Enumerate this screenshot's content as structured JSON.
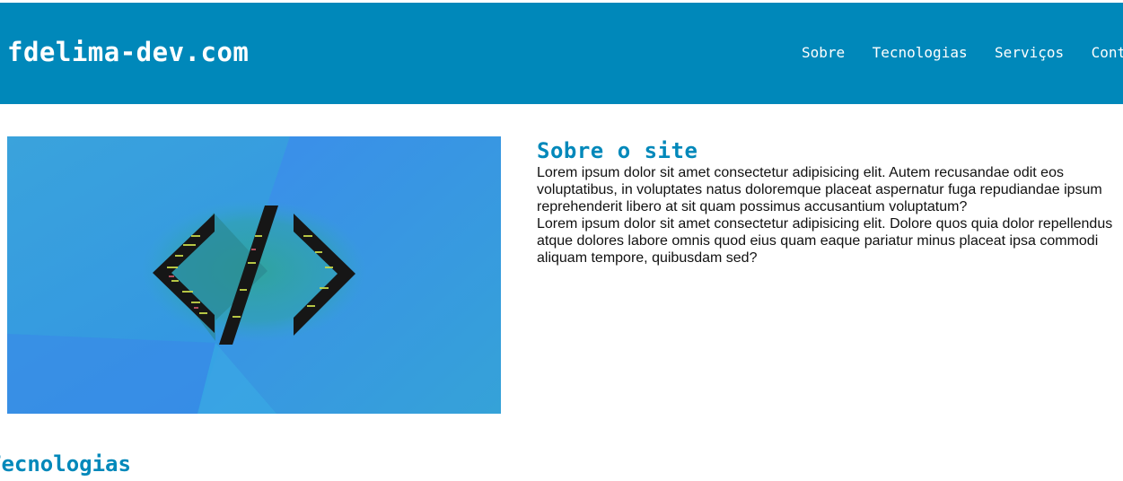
{
  "header": {
    "logo": "fdelima-dev.com",
    "nav": [
      "Sobre",
      "Tecnologias",
      "Serviços",
      "Contato"
    ],
    "background": "#0088ba"
  },
  "hero": {
    "image_icon": "code-brackets-icon"
  },
  "about": {
    "title": "Sobre o site",
    "paragraphs": [
      "Lorem ipsum dolor sit amet consectetur adipisicing elit. Autem recusandae odit eos voluptatibus, in voluptates natus doloremque placeat aspernatur fuga repudiandae ipsum reprehenderit libero at sit quam possimus accusantium voluptatum?",
      "Lorem ipsum dolor sit amet consectetur adipisicing elit. Dolore quos quia dolor repellendus atque dolores labore omnis quod eius quam eaque pariatur minus placeat ipsa commodi aliquam tempore, quibusdam sed?"
    ]
  },
  "technologies": {
    "title": "Tecnologias"
  }
}
